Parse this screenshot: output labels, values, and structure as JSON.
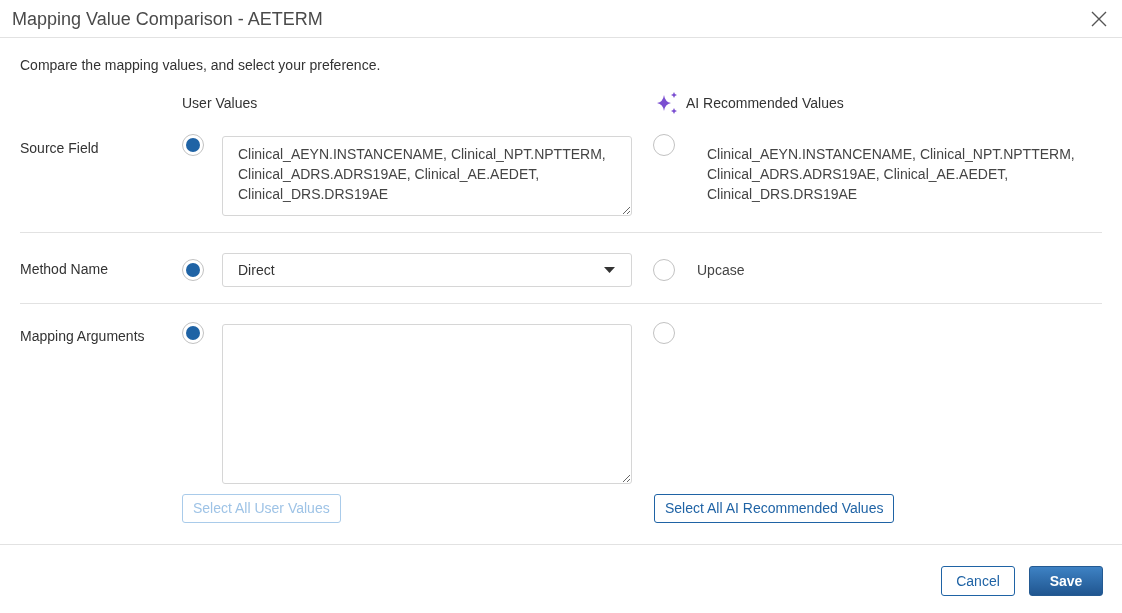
{
  "dialog": {
    "title": "Mapping Value Comparison - AETERM",
    "instruction": "Compare the mapping values, and select your preference.",
    "columns": {
      "user": "User Values",
      "ai": "AI Recommended Values"
    },
    "rows": [
      {
        "label": "Source Field",
        "kind": "fieldlist",
        "user": {
          "selected": true,
          "value": "Clinical_AEYN.INSTANCENAME, Clinical_NPT.NPTTERM, Clinical_ADRS.ADRS19AE, Clinical_AE.AEDET, Clinical_DRS.DRS19AE"
        },
        "ai": {
          "selected": false,
          "value": "Clinical_AEYN.INSTANCENAME, Clinical_NPT.NPTTERM, Clinical_ADRS.ADRS19AE, Clinical_AE.AEDET, Clinical_DRS.DRS19AE"
        }
      },
      {
        "label": "Method Name",
        "kind": "dropdown",
        "user": {
          "selected": true,
          "value": "Direct"
        },
        "ai": {
          "selected": false,
          "value": "Upcase"
        }
      },
      {
        "label": "Mapping Arguments",
        "kind": "freetext",
        "user": {
          "selected": true
        },
        "ai": {
          "selected": false
        }
      }
    ],
    "select_all": [
      {
        "label": "Select All User Values",
        "disabled": true
      },
      {
        "label": "Select All AI Recommended Values",
        "disabled": false
      }
    ],
    "footer_buttons": [
      {
        "label": "Cancel",
        "kind": "secondary"
      },
      {
        "label": "Save",
        "kind": "primary"
      }
    ]
  }
}
